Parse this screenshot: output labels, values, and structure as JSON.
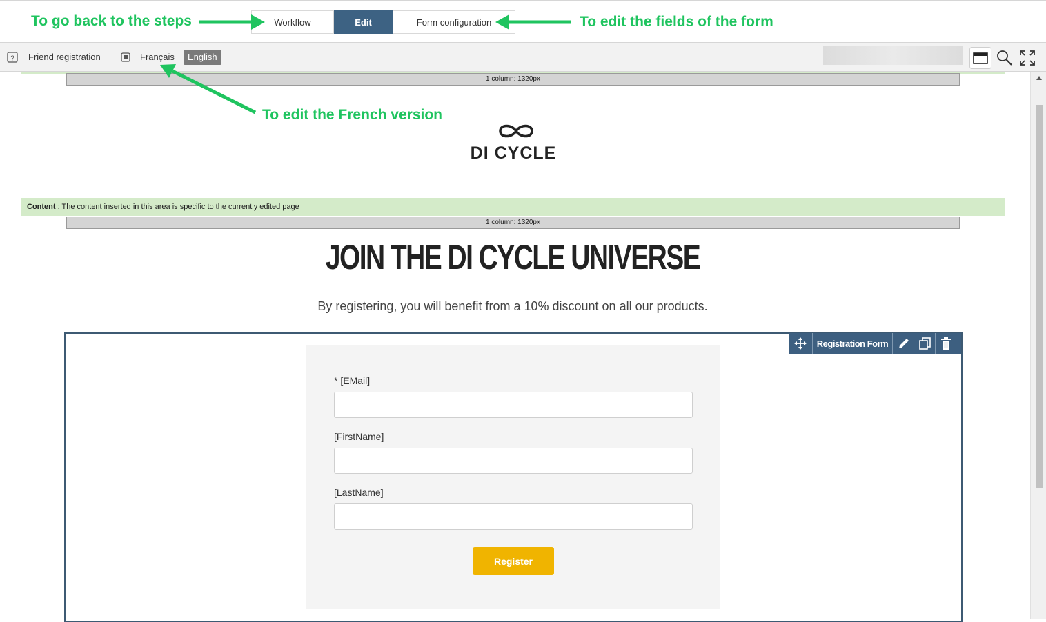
{
  "steps": {
    "workflow_label": "Workflow",
    "edit_label": "Edit",
    "form_config_label": "Form configuration"
  },
  "annotations": {
    "back_to_steps": "To go back to the steps",
    "edit_fields": "To edit the fields of the form",
    "edit_french": "To edit the French version"
  },
  "toolbar": {
    "page_name": "Friend registration",
    "lang_fr": "Français",
    "lang_en": "English",
    "active_language": "English"
  },
  "canvas": {
    "column_bar_top": "1 column: 1320px",
    "column_bar_content": "1 column: 1320px",
    "logo_text": "DI CYCLE",
    "content_band_bold": "Content",
    "content_band_text": " : The content inserted in this area is specific to the currently edited page",
    "headline": "JOIN THE DI CYCLE UNIVERSE",
    "subheadline": "By registering, you will benefit from a 10% discount on all our products."
  },
  "form_block": {
    "toolbar_label": "Registration Form",
    "fields": [
      {
        "label": "* [EMail]",
        "value": ""
      },
      {
        "label": "[FirstName]",
        "value": ""
      },
      {
        "label": "[LastName]",
        "value": ""
      }
    ],
    "submit_label": "Register"
  },
  "colors": {
    "annotation_green": "#1fc45f",
    "active_tab": "#3d6283",
    "register_button": "#f0b400",
    "content_band": "#d4ebc9"
  }
}
